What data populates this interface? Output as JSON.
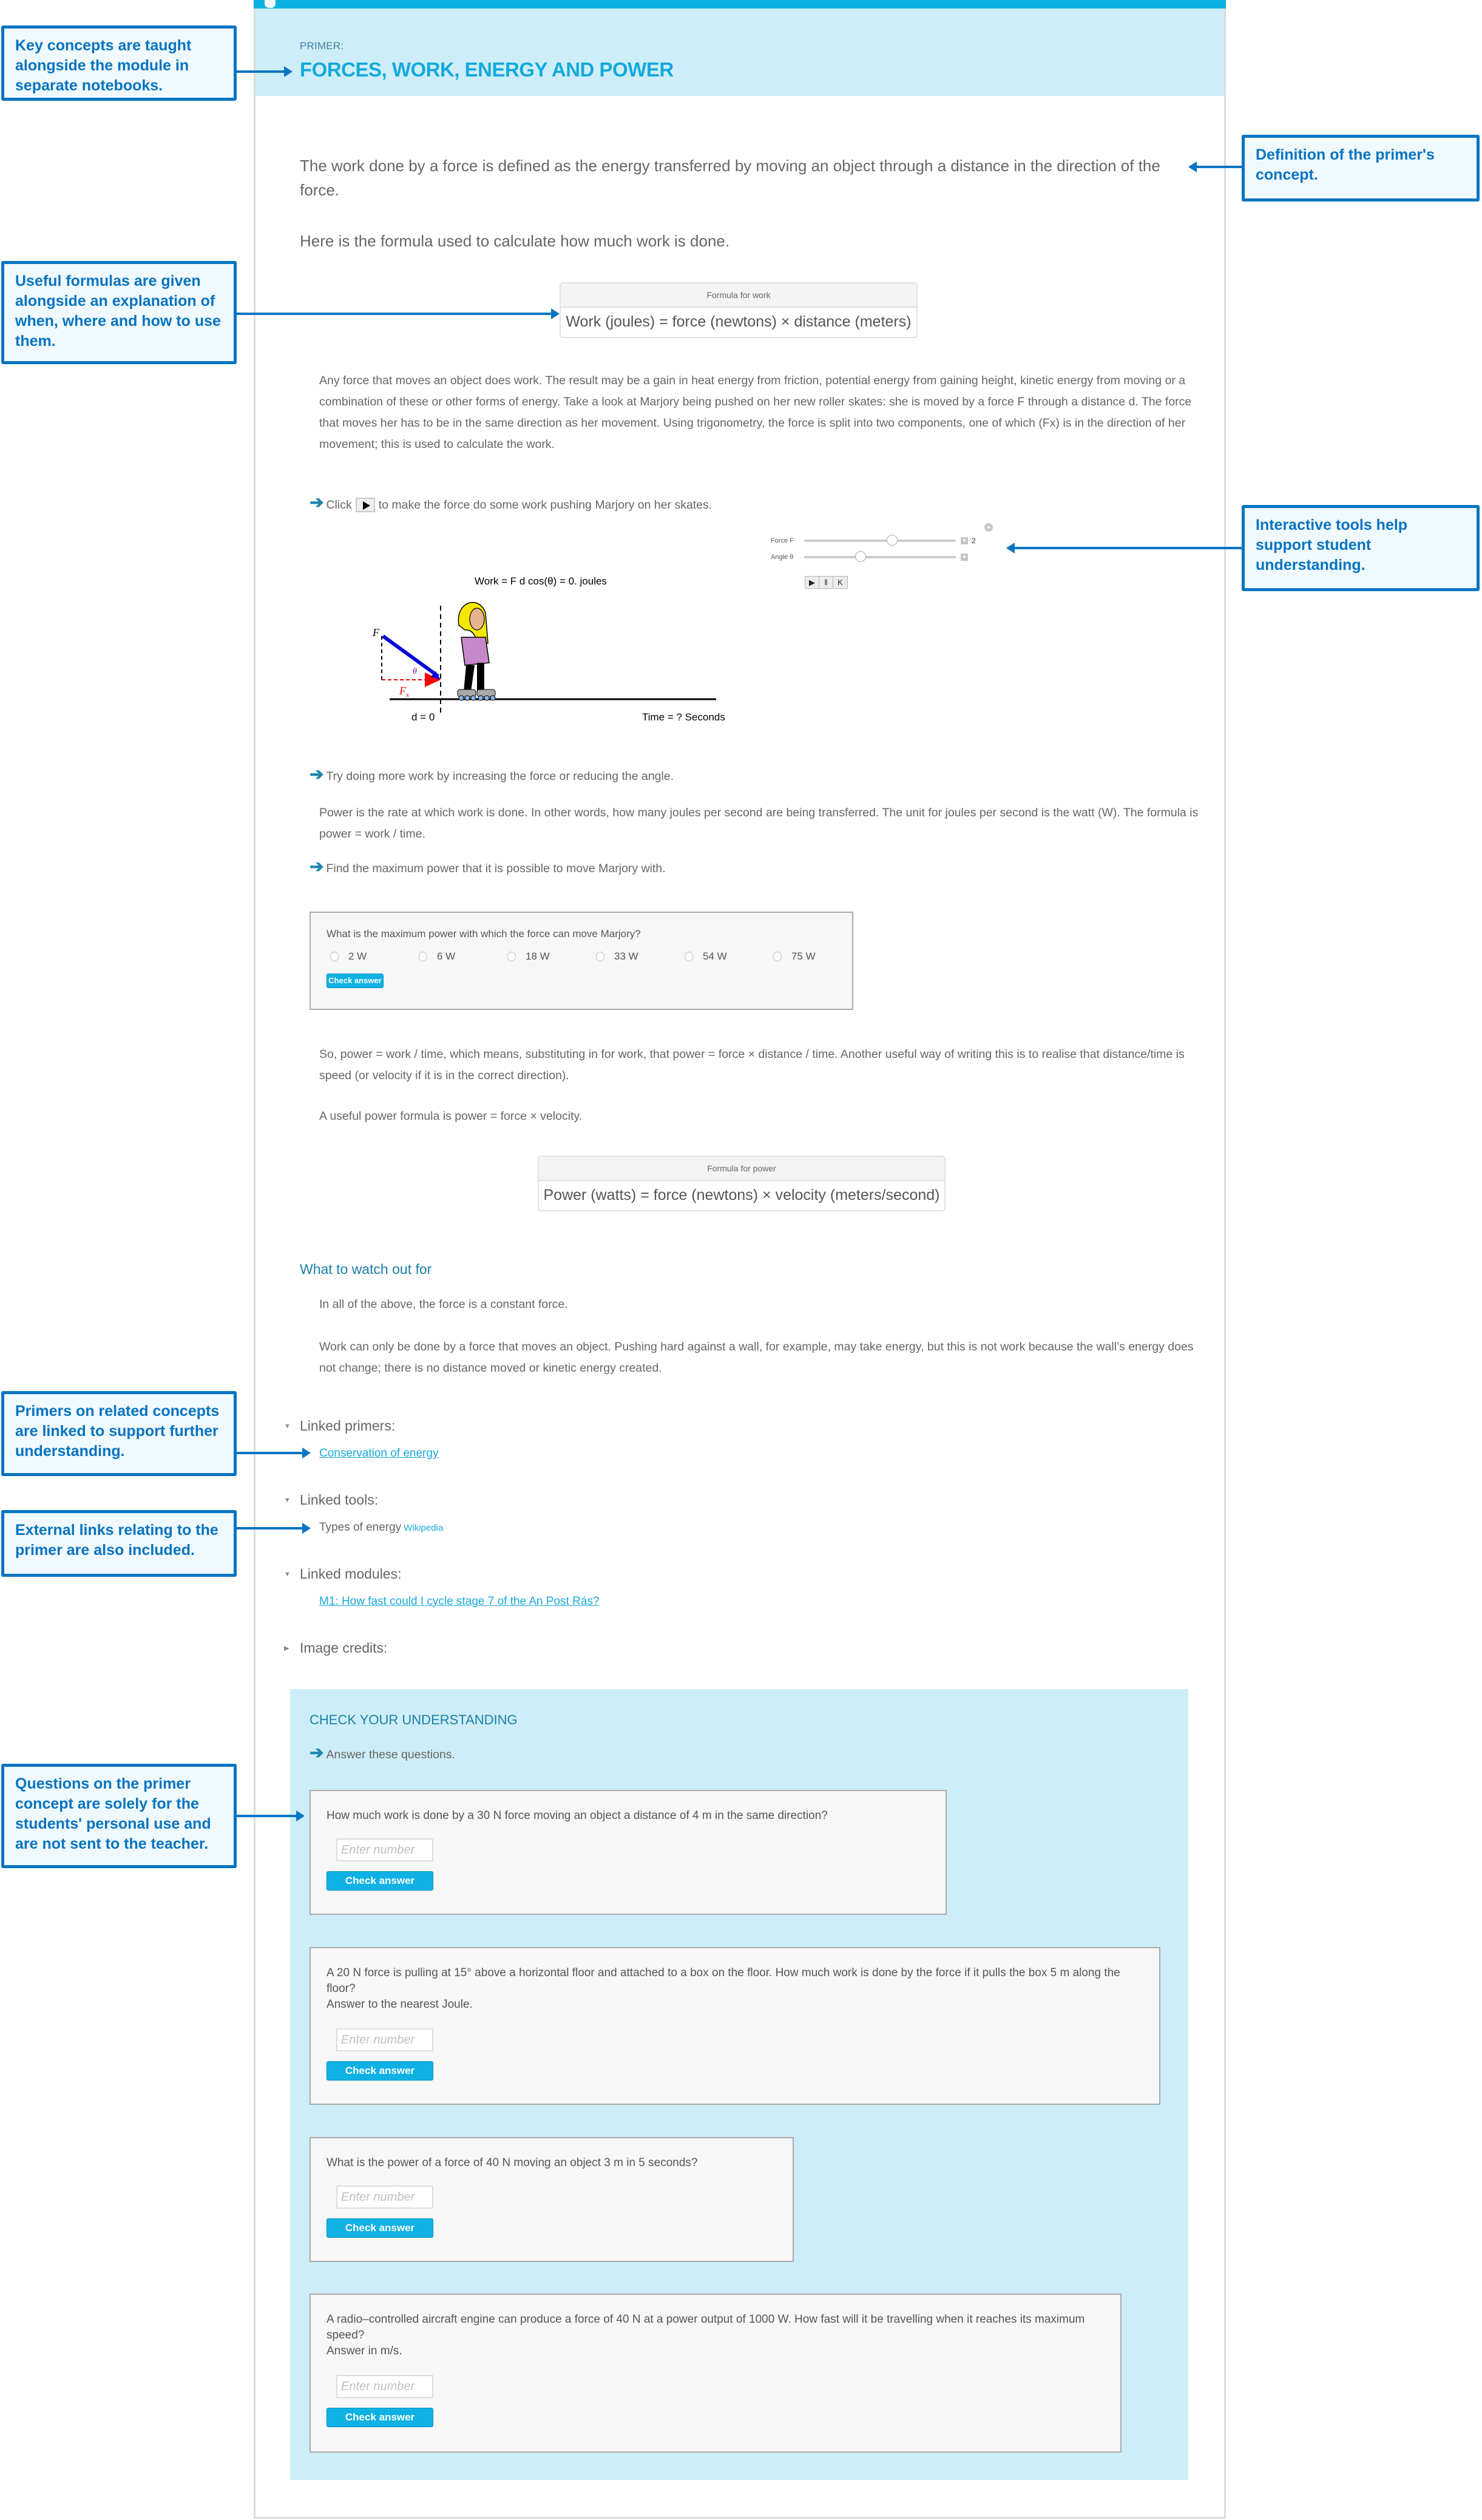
{
  "header": {
    "label": "PRIMER:",
    "title": "FORCES, WORK, ENERGY AND POWER"
  },
  "intro": {
    "definition": "The work done by a force is defined as the energy transferred by moving an object through a distance in the direction of the force.",
    "formula_intro": "Here is the formula used to calculate how much work is done."
  },
  "formula_work": {
    "heading": "Formula for work",
    "body": "Work (joules) = force (newtons) × distance (meters)"
  },
  "paragraphs": {
    "any_force": "Any force that moves an object does work. The result may be a gain in heat energy from friction, potential energy from gaining height, kinetic energy from moving or a combination of these or other forms of energy. Take a look at Marjory being pushed on her new roller skates: she is moved by a force F through a distance d. The force that moves her has to be in the same direction as her movement. Using trigonometry, the force is split into two components, one of which (Fx) is in the direction of her movement; this is used to calculate the work.",
    "power_def": "Power is the rate at which work is done. In other words, how many joules per second are being transferred. The unit for joules per second is the watt (W). The formula is power = work / time.",
    "so_power": "So, power = work / time, which means, substituting in for work, that power = force × distance / time. Another useful way of writing this is to realise that distance/time is speed (or velocity if it is in the correct direction).",
    "useful_power": "A useful power formula is power = force × velocity."
  },
  "instructions": {
    "click_pre": "Click",
    "click_post": "to make the force do some work pushing Marjory on her skates.",
    "try_more": "Try doing more work by increasing the force or reducing the angle.",
    "find_max": "Find the maximum power that it is possible to move Marjory with.",
    "answer_these": "Answer these questions."
  },
  "tool": {
    "force_label": "Force F",
    "force_value": "2",
    "force_fraction": 0.58,
    "angle_label": "Angle θ",
    "angle_fraction": 0.37,
    "work_equation": "Work = F d cos(θ) = 0. joules",
    "distance_label": "d = 0",
    "time_label": "Time =  ?   Seconds",
    "vector_labels": {
      "force": "F",
      "component": "Fx",
      "angle": "θ"
    },
    "controls": [
      "play",
      "pause",
      "reset"
    ]
  },
  "mc_quiz": {
    "question": "What is the maximum power with which the force can move Marjory?",
    "options": [
      "2 W",
      "6 W",
      "18 W",
      "33 W",
      "54 W",
      "75 W"
    ],
    "button": "Check answer"
  },
  "formula_power": {
    "heading": "Formula for power",
    "body": "Power (watts) = force (newtons) × velocity (meters/second)"
  },
  "watch_out": {
    "title": "What to watch out for",
    "p1": "In all of the above, the force is a constant force.",
    "p2": "Work can only be done by a force that moves an object. Pushing hard against a wall, for example, may take energy, but this is not work because the wall’s energy does not change; there is no distance moved or kinetic energy created."
  },
  "linked": {
    "primers_title": "Linked primers:",
    "primers": [
      "Conservation of energy"
    ],
    "tools_title": "Linked tools:",
    "tools": [
      {
        "label": "Types of energy",
        "source": "Wikipedia"
      }
    ],
    "modules_title": "Linked modules:",
    "modules": [
      "M1: How fast could I cycle stage 7 of the An Post Rás?"
    ],
    "credits_title": "Image credits:"
  },
  "check_understanding": {
    "title": "CHECK YOUR UNDERSTANDING",
    "placeholder": "Enter number",
    "button": "Check answer",
    "questions": [
      {
        "text": "How much work is done by a 30 N force moving an object a distance of 4 m in the same direction?"
      },
      {
        "text": "A 20 N force is pulling at 15° above a horizontal floor and attached to a box on the floor. How much work is done by the force if it pulls the box 5 m along the floor?",
        "note": "Answer to the nearest Joule."
      },
      {
        "text": "What is the power of a force of 40 N moving an object 3 m in 5 seconds?"
      },
      {
        "text": "A radio–controlled aircraft engine can produce a force of 40 N at a power output of 1000 W. How fast will it be travelling when it reaches its maximum speed?",
        "note": "Answer in m/s."
      }
    ]
  },
  "callouts": {
    "key_concepts": "Key concepts are taught alongside the module in separate notebooks.",
    "formulas": "Useful formulas are given alongside an explanation of when, where and how to use them.",
    "definition": "Definition of the primer's concept.",
    "interactive": "Interactive tools help support student understanding.",
    "linked_primers": "Primers on related concepts are linked to support further understanding.",
    "external_links": "External links relating to the primer are also included.",
    "questions": "Questions on the primer concept are solely for the students' personal use and are not sent to the teacher."
  },
  "colors": {
    "brand": "#0bb0e2",
    "header_bg": "#cdeef8",
    "callout_border": "#0674c2",
    "link": "#19a9dc",
    "button": "#0eb1e4"
  }
}
